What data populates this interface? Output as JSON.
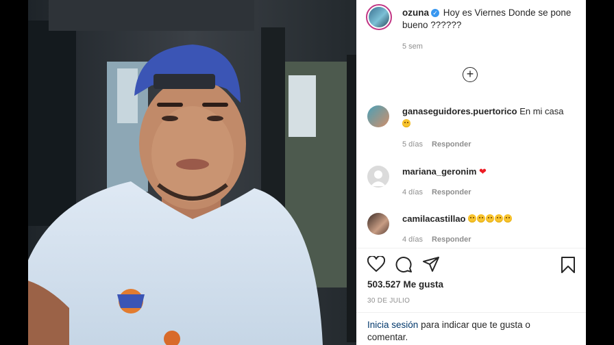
{
  "post": {
    "author": "ozuna",
    "caption": "Hoy es Viernes Donde se pone bueno ??????",
    "time": "5 sem",
    "likes": "503.527 Me gusta",
    "date": "30 DE JULIO"
  },
  "comments": [
    {
      "user": "ganaseguidores.puertorico",
      "text": "En mi casa",
      "emoji": "smile",
      "time": "5 días",
      "reply": "Responder"
    },
    {
      "user": "mariana_geronim",
      "text": "",
      "emoji": "heart",
      "time": "4 días",
      "reply": "Responder"
    },
    {
      "user": "camilacastillao",
      "text": "",
      "emoji": "smile-x5",
      "time": "4 días",
      "reply": "Responder"
    }
  ],
  "actions": {
    "like": "heart-icon",
    "comment": "comment-icon",
    "share": "share-icon",
    "save": "bookmark-icon"
  },
  "login": {
    "link": "Inicia sesión",
    "rest": "para indicar que te gusta o comentar."
  },
  "colors": {
    "link": "#00376b",
    "verified": "#3897f0",
    "heart": "#ed1c24",
    "muted": "#8e8e8e"
  }
}
